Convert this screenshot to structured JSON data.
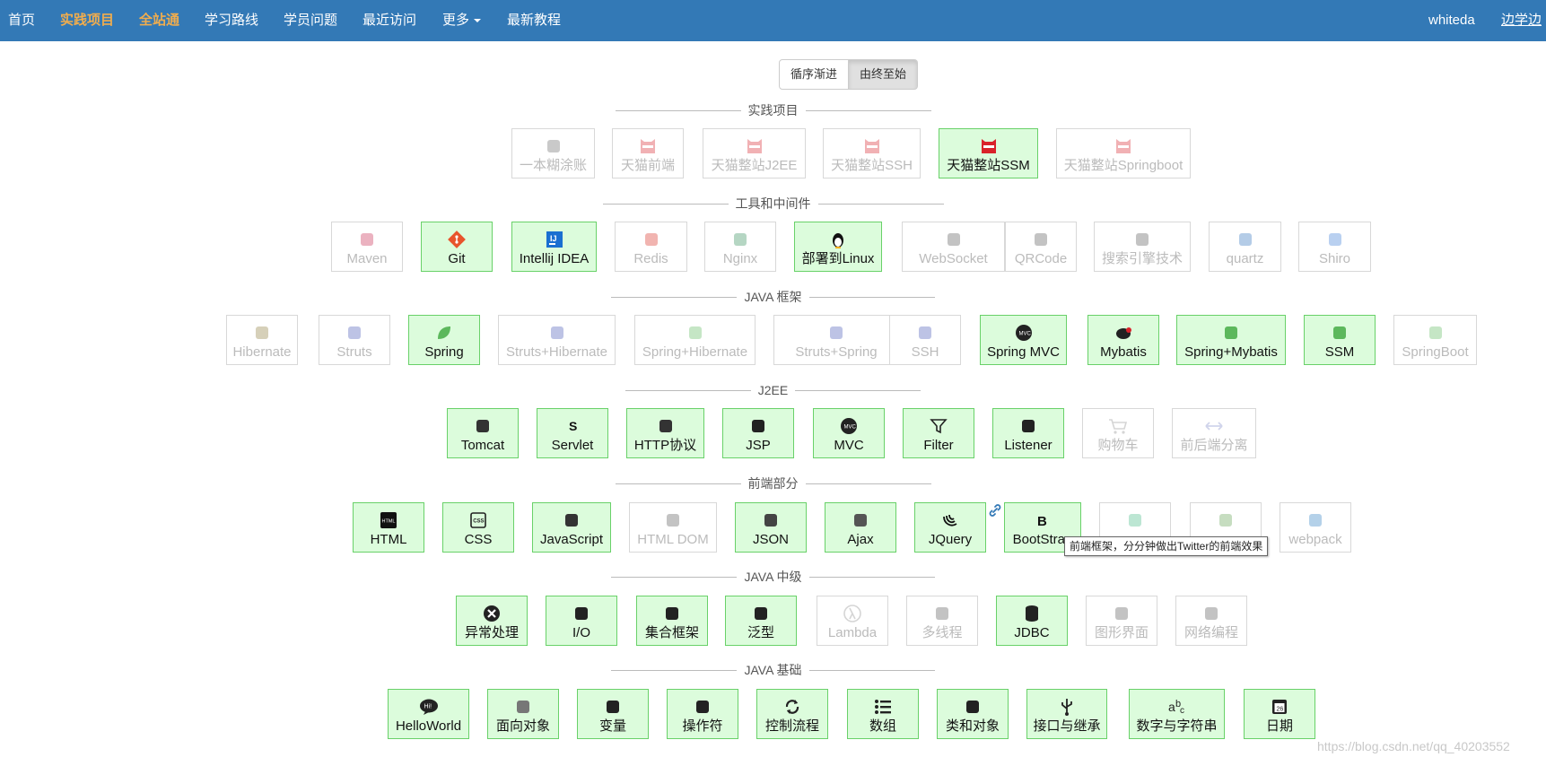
{
  "nav": {
    "items": [
      {
        "label": "首页",
        "highlight": false
      },
      {
        "label": "实践项目",
        "highlight": true
      },
      {
        "label": "全站通",
        "highlight": true
      },
      {
        "label": "学习路线",
        "highlight": false
      },
      {
        "label": "学员问题",
        "highlight": false
      },
      {
        "label": "最近访问",
        "highlight": false
      },
      {
        "label": "更多",
        "highlight": false
      },
      {
        "label": "最新教程",
        "highlight": false
      }
    ],
    "user": "whiteda",
    "link": "边学边"
  },
  "toggle": {
    "options": [
      "循序渐进",
      "由终至始"
    ],
    "selected": "由终至始"
  },
  "sections": [
    {
      "title": "实践项目",
      "items": [
        {
          "label": "一本糊涂账",
          "active": false,
          "icon": "wallet-icon"
        },
        {
          "label": "天猫前端",
          "active": false,
          "icon": "tmall-cat-icon"
        },
        {
          "label": "天猫整站J2EE",
          "active": false,
          "icon": "tmall-cat-icon"
        },
        {
          "label": "天猫整站SSH",
          "active": false,
          "icon": "tmall-cat-icon"
        },
        {
          "label": "天猫整站SSM",
          "active": true,
          "icon": "tmall-cat-icon"
        },
        {
          "label": "天猫整站Springboot",
          "active": false,
          "icon": "tmall-cat-icon"
        }
      ]
    },
    {
      "title": "工具和中间件",
      "items": [
        {
          "label": "Maven",
          "active": false,
          "icon": "maven-icon"
        },
        {
          "label": "Git",
          "active": true,
          "icon": "git-icon"
        },
        {
          "label": "Intellij IDEA",
          "active": true,
          "icon": "idea-icon"
        },
        {
          "label": "Redis",
          "active": false,
          "icon": "redis-icon"
        },
        {
          "label": "Nginx",
          "active": false,
          "icon": "nginx-icon"
        },
        {
          "label": "部署到Linux",
          "active": true,
          "icon": "linux-penguin-icon"
        },
        {
          "label": "WebSocket",
          "active": false,
          "icon": "websocket-icon"
        },
        {
          "label": "QRCode",
          "active": false,
          "icon": "qrcode-icon"
        },
        {
          "label": "搜索引擎技术",
          "active": false,
          "icon": "magnifier-icon"
        },
        {
          "label": "quartz",
          "active": false,
          "icon": "quartz-icon"
        },
        {
          "label": "Shiro",
          "active": false,
          "icon": "shiro-icon"
        }
      ]
    },
    {
      "title": "JAVA 框架",
      "items": [
        {
          "label": "Hibernate",
          "active": false,
          "icon": "hibernate-icon"
        },
        {
          "label": "Struts",
          "active": false,
          "icon": "struts-icon"
        },
        {
          "label": "Spring",
          "active": true,
          "icon": "spring-leaf-icon"
        },
        {
          "label": "Struts+Hibernate",
          "active": false,
          "icon": "struts-hibernate-icon"
        },
        {
          "label": "Spring+Hibernate",
          "active": false,
          "icon": "spring-hibernate-icon"
        },
        {
          "label": "Struts+Spring",
          "active": false,
          "icon": "struts-spring-icon"
        },
        {
          "label": "SSH",
          "active": false,
          "icon": "ssh-icon"
        },
        {
          "label": "Spring MVC",
          "active": true,
          "icon": "mvc-icon"
        },
        {
          "label": "Mybatis",
          "active": true,
          "icon": "mybatis-bird-icon"
        },
        {
          "label": "Spring+Mybatis",
          "active": true,
          "icon": "spring-mybatis-icon"
        },
        {
          "label": "SSM",
          "active": true,
          "icon": "ssm-icon"
        },
        {
          "label": "SpringBoot",
          "active": false,
          "icon": "springboot-icon"
        }
      ]
    },
    {
      "title": "J2EE",
      "items": [
        {
          "label": "Tomcat",
          "active": true,
          "icon": "tomcat-icon"
        },
        {
          "label": "Servlet",
          "active": true,
          "icon": "servlet-icon"
        },
        {
          "label": "HTTP协议",
          "active": true,
          "icon": "http-icon"
        },
        {
          "label": "JSP",
          "active": true,
          "icon": "jsp-icon"
        },
        {
          "label": "MVC",
          "active": true,
          "icon": "mvc-icon"
        },
        {
          "label": "Filter",
          "active": true,
          "icon": "filter-icon"
        },
        {
          "label": "Listener",
          "active": true,
          "icon": "headset-icon"
        },
        {
          "label": "购物车",
          "active": false,
          "icon": "cart-icon"
        },
        {
          "label": "前后端分离",
          "active": false,
          "icon": "arrows-icon"
        }
      ]
    },
    {
      "title": "前端部分",
      "items": [
        {
          "label": "HTML",
          "active": true,
          "icon": "html-icon"
        },
        {
          "label": "CSS",
          "active": true,
          "icon": "css-icon"
        },
        {
          "label": "JavaScript",
          "active": true,
          "icon": "javascript-icon"
        },
        {
          "label": "HTML DOM",
          "active": false,
          "icon": "dom-tree-icon"
        },
        {
          "label": "JSON",
          "active": true,
          "icon": "json-icon"
        },
        {
          "label": "Ajax",
          "active": true,
          "icon": "ajax-icon"
        },
        {
          "label": "JQuery",
          "active": true,
          "icon": "jquery-icon"
        },
        {
          "label": "BootStrap",
          "active": true,
          "icon": "bootstrap-icon"
        },
        {
          "label": "",
          "active": false,
          "icon": "vue-icon"
        },
        {
          "label": "",
          "active": false,
          "icon": "node-icon"
        },
        {
          "label": "webpack",
          "active": false,
          "icon": "webpack-icon"
        }
      ]
    },
    {
      "title": "JAVA 中级",
      "items": [
        {
          "label": "异常处理",
          "active": true,
          "icon": "exception-icon"
        },
        {
          "label": "I/O",
          "active": true,
          "icon": "file-icon"
        },
        {
          "label": "集合框架",
          "active": true,
          "icon": "list-icon"
        },
        {
          "label": "泛型",
          "active": true,
          "icon": "generic-icon"
        },
        {
          "label": "Lambda",
          "active": false,
          "icon": "lambda-icon"
        },
        {
          "label": "多线程",
          "active": false,
          "icon": "thread-icon"
        },
        {
          "label": "JDBC",
          "active": true,
          "icon": "database-icon"
        },
        {
          "label": "图形界面",
          "active": false,
          "icon": "gui-icon"
        },
        {
          "label": "网络编程",
          "active": false,
          "icon": "network-icon"
        }
      ]
    },
    {
      "title": "JAVA 基础",
      "items": [
        {
          "label": "HelloWorld",
          "active": true,
          "icon": "hello-bubble-icon"
        },
        {
          "label": "面向对象",
          "active": true,
          "icon": "object-icon"
        },
        {
          "label": "变量",
          "active": true,
          "icon": "variable-icon"
        },
        {
          "label": "操作符",
          "active": true,
          "icon": "operator-icon"
        },
        {
          "label": "控制流程",
          "active": true,
          "icon": "refresh-icon"
        },
        {
          "label": "数组",
          "active": true,
          "icon": "array-list-icon"
        },
        {
          "label": "类和对象",
          "active": true,
          "icon": "class-icon"
        },
        {
          "label": "接口与继承",
          "active": true,
          "icon": "usb-icon"
        },
        {
          "label": "数字与字符串",
          "active": true,
          "icon": "abc-icon"
        },
        {
          "label": "日期",
          "active": true,
          "icon": "calendar-icon"
        }
      ]
    }
  ],
  "tooltip": "前端框架，分分钟做出Twitter的前端效果",
  "watermark": "https://blog.csdn.net/qq_40203552",
  "colors": {
    "navbar": "#3379b6",
    "nav_highlight": "#f0ad4e",
    "active_bg": "#dcfcdc",
    "active_border": "#69d169"
  }
}
